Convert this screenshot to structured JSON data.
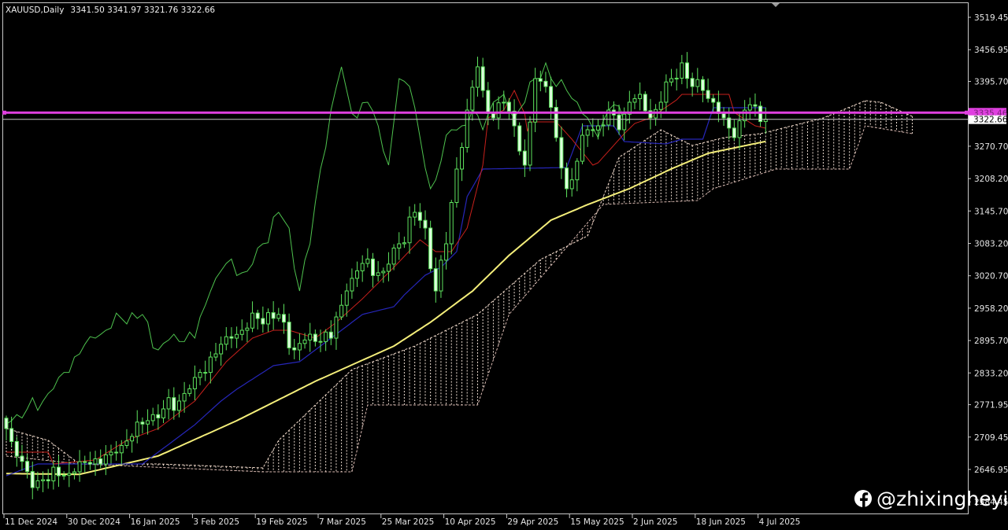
{
  "header": {
    "symbol": "XAUUSD,Daily",
    "ohlc": "3341.50 3341.97 3321.76 3322.66"
  },
  "watermark": {
    "icon": "facebook-icon",
    "handle": "@zhixingheyi"
  },
  "chart_data": {
    "type": "candlestick",
    "title": "XAUUSD,Daily",
    "ylim": [
      2584.45,
      3519.45
    ],
    "y_ticks": [
      "3519.45",
      "3456.95",
      "3395.70",
      "3270.70",
      "3208.20",
      "3145.70",
      "3083.20",
      "3020.70",
      "2958.20",
      "2895.70",
      "2833.20",
      "2771.95",
      "2709.45",
      "2646.95",
      "2584.45"
    ],
    "x_ticks": [
      {
        "bar": 0,
        "label": "11 Dec 2024"
      },
      {
        "bar": 12,
        "label": "30 Dec 2024"
      },
      {
        "bar": 24,
        "label": "16 Jan 2025"
      },
      {
        "bar": 36,
        "label": "3 Feb 2025"
      },
      {
        "bar": 48,
        "label": "19 Feb 2025"
      },
      {
        "bar": 60,
        "label": "7 Mar 2025"
      },
      {
        "bar": 72,
        "label": "25 Mar 2025"
      },
      {
        "bar": 84,
        "label": "10 Apr 2025"
      },
      {
        "bar": 96,
        "label": "29 Apr 2025"
      },
      {
        "bar": 108,
        "label": "15 May 2025"
      },
      {
        "bar": 120,
        "label": "2 Jun 2025"
      },
      {
        "bar": 132,
        "label": "18 Jun 2025"
      },
      {
        "bar": 144,
        "label": "4 Jul 2025"
      }
    ],
    "bar_count": 146,
    "last_close": 3322.66,
    "close_keypoints": [
      [
        0,
        2725.9
      ],
      [
        2,
        2672.7
      ],
      [
        5,
        2612.0
      ],
      [
        7,
        2627.2
      ],
      [
        10,
        2634.8
      ],
      [
        13,
        2642.4
      ],
      [
        16,
        2657.6
      ],
      [
        20,
        2680.3
      ],
      [
        24,
        2710.7
      ],
      [
        27,
        2741.1
      ],
      [
        30,
        2763.8
      ],
      [
        33,
        2779.0
      ],
      [
        36,
        2824.5
      ],
      [
        40,
        2870.0
      ],
      [
        43,
        2900.3
      ],
      [
        45,
        2915.5
      ],
      [
        48,
        2938.3
      ],
      [
        52,
        2946.1
      ],
      [
        55,
        2877.6
      ],
      [
        58,
        2907.9
      ],
      [
        62,
        2900.3
      ],
      [
        65,
        2991.4
      ],
      [
        68,
        3044.5
      ],
      [
        72,
        3029.3
      ],
      [
        75,
        3082.4
      ],
      [
        78,
        3143.1
      ],
      [
        80,
        3112.8
      ],
      [
        82,
        2991.4
      ],
      [
        84,
        3082.4
      ],
      [
        86,
        3226.6
      ],
      [
        88,
        3340.4
      ],
      [
        90,
        3423.9
      ],
      [
        91,
        3378.3
      ],
      [
        93,
        3325.2
      ],
      [
        95,
        3355.6
      ],
      [
        97,
        3310.0
      ],
      [
        99,
        3234.2
      ],
      [
        101,
        3401.1
      ],
      [
        103,
        3385.9
      ],
      [
        105,
        3287.3
      ],
      [
        107,
        3188.7
      ],
      [
        109,
        3241.7
      ],
      [
        111,
        3302.5
      ],
      [
        113,
        3310.0
      ],
      [
        115,
        3340.4
      ],
      [
        117,
        3302.5
      ],
      [
        119,
        3355.6
      ],
      [
        121,
        3370.8
      ],
      [
        123,
        3325.2
      ],
      [
        125,
        3355.6
      ],
      [
        127,
        3401.1
      ],
      [
        129,
        3431.5
      ],
      [
        131,
        3385.9
      ],
      [
        133,
        3378.3
      ],
      [
        135,
        3355.6
      ],
      [
        137,
        3325.2
      ],
      [
        139,
        3287.3
      ],
      [
        141,
        3340.4
      ],
      [
        143,
        3348.0
      ],
      [
        145,
        3322.66
      ]
    ],
    "series": [
      {
        "name": "Tenkan-sen",
        "color": "#c8201c",
        "points": [
          [
            0,
            2680.3
          ],
          [
            8,
            2680.3
          ],
          [
            9,
            2657.6
          ],
          [
            17,
            2665.2
          ],
          [
            23,
            2703.1
          ],
          [
            29,
            2725.9
          ],
          [
            36,
            2779.0
          ],
          [
            42,
            2854.8
          ],
          [
            47,
            2900.3
          ],
          [
            51,
            2915.5
          ],
          [
            54,
            2915.5
          ],
          [
            59,
            2900.3
          ],
          [
            63,
            2930.7
          ],
          [
            68,
            2976.2
          ],
          [
            74,
            3036.9
          ],
          [
            79,
            3090.0
          ],
          [
            82,
            3067.3
          ],
          [
            85,
            3067.3
          ],
          [
            88,
            3112.8
          ],
          [
            91,
            3234.2
          ],
          [
            92,
            3325.2
          ],
          [
            95,
            3340.4
          ],
          [
            97,
            3378.3
          ],
          [
            99,
            3332.8
          ],
          [
            99.5,
            3299.4
          ],
          [
            100,
            3317.6
          ],
          [
            105,
            3317.6
          ],
          [
            108,
            3284.2
          ],
          [
            112,
            3234.2
          ],
          [
            113,
            3238.7
          ],
          [
            118,
            3294.9
          ],
          [
            120,
            3314.6
          ],
          [
            123,
            3325.2
          ],
          [
            128,
            3360.1
          ],
          [
            129,
            3370.8
          ],
          [
            138,
            3370.8
          ],
          [
            139,
            3335.8
          ],
          [
            143,
            3310.0
          ],
          [
            145,
            3305.5
          ]
        ]
      },
      {
        "name": "Kijun-sen",
        "color": "#2626b8",
        "points": [
          [
            0,
            2634.8
          ],
          [
            6,
            2657.6
          ],
          [
            26,
            2657.6
          ],
          [
            29,
            2680.3
          ],
          [
            36,
            2733.2
          ],
          [
            41,
            2779.0
          ],
          [
            44,
            2801.7
          ],
          [
            51,
            2847.2
          ],
          [
            56,
            2854.8
          ],
          [
            59,
            2877.6
          ],
          [
            64,
            2915.5
          ],
          [
            68,
            2946.1
          ],
          [
            74,
            2961.0
          ],
          [
            76,
            2983.8
          ],
          [
            80,
            3021.9
          ],
          [
            83,
            3036.9
          ],
          [
            86,
            3067.3
          ],
          [
            88,
            3173.5
          ],
          [
            91,
            3226.6
          ],
          [
            107,
            3229.6
          ],
          [
            110,
            3310.0
          ],
          [
            116,
            3310.0
          ],
          [
            118,
            3279.7
          ],
          [
            126,
            3275.1
          ],
          [
            129,
            3284.2
          ],
          [
            133,
            3284.2
          ],
          [
            135,
            3344.9
          ],
          [
            145,
            3344.9
          ]
        ]
      },
      {
        "name": "Moving Average",
        "color": "#f4ee7a",
        "points": [
          [
            0,
            2639.0
          ],
          [
            14,
            2637.5
          ],
          [
            29,
            2673.0
          ],
          [
            44,
            2741.0
          ],
          [
            59,
            2817.0
          ],
          [
            74,
            2885.0
          ],
          [
            81,
            2931.0
          ],
          [
            89,
            2991.0
          ],
          [
            96,
            3060.0
          ],
          [
            104,
            3128.0
          ],
          [
            111,
            3158.0
          ],
          [
            119,
            3189.0
          ],
          [
            127,
            3227.0
          ],
          [
            134,
            3257.0
          ],
          [
            145,
            3280.0
          ]
        ]
      },
      {
        "name": "Senkou Span A",
        "color": "#f0d8c8",
        "points": [
          [
            0,
            2725.9
          ],
          [
            8,
            2703.1
          ],
          [
            14,
            2657.6
          ],
          [
            29,
            2657.6
          ],
          [
            49,
            2650.0
          ],
          [
            52,
            2703.1
          ],
          [
            66,
            2839.7
          ],
          [
            78,
            2885.2
          ],
          [
            90,
            2946.1
          ],
          [
            102,
            3052.1
          ],
          [
            111,
            3097.6
          ],
          [
            117,
            3249.3
          ],
          [
            125,
            3302.5
          ],
          [
            131,
            3272.1
          ],
          [
            137,
            3287.3
          ],
          [
            144,
            3294.9
          ],
          [
            156,
            3325.2
          ],
          [
            164,
            3358.6
          ],
          [
            167,
            3355.6
          ],
          [
            173,
            3328.3
          ]
        ]
      },
      {
        "name": "Senkou Span B",
        "color": "#d8b8b0",
        "points": [
          [
            0,
            2672.7
          ],
          [
            14,
            2657.6
          ],
          [
            49,
            2642.4
          ],
          [
            66,
            2642.4
          ],
          [
            69,
            2771.4
          ],
          [
            90,
            2771.4
          ],
          [
            96,
            2946.1
          ],
          [
            105,
            3052.1
          ],
          [
            114,
            3158.3
          ],
          [
            132,
            3165.9
          ],
          [
            135,
            3188.7
          ],
          [
            147,
            3226.6
          ],
          [
            161,
            3226.6
          ],
          [
            164,
            3310.0
          ],
          [
            173,
            3294.9
          ]
        ]
      }
    ],
    "chikou_shift": 26,
    "horizontal_lines": [
      {
        "name": "price-line",
        "value": "3335.46",
        "color": "#e040e0"
      },
      {
        "name": "bid-line",
        "value": "3322.66",
        "color": "#c8c8c8"
      }
    ]
  }
}
